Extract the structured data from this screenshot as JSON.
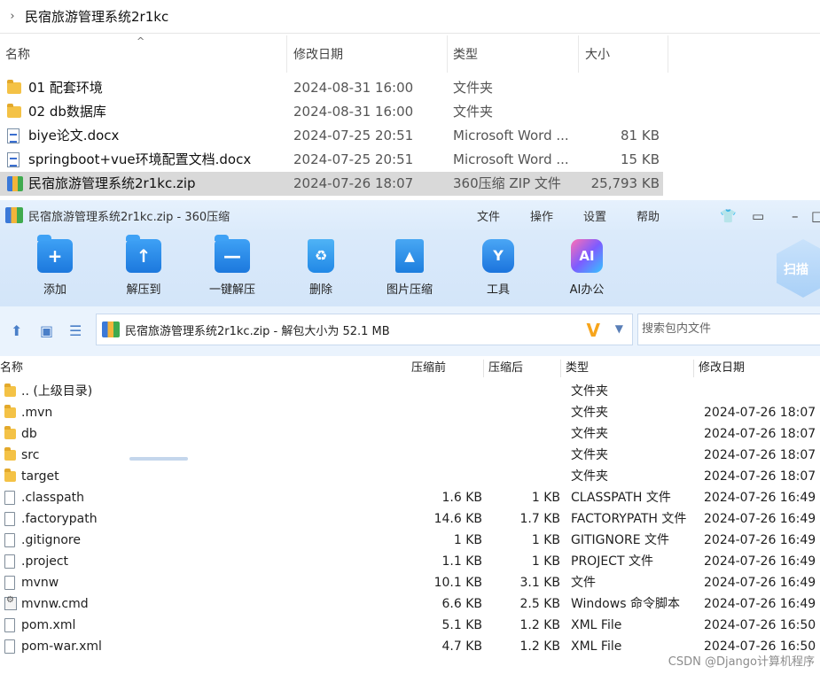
{
  "explorer": {
    "path": "民宿旅游管理系统2r1kc",
    "columns": {
      "name": "名称",
      "date": "修改日期",
      "type": "类型",
      "size": "大小"
    },
    "rows": [
      {
        "icon": "folder-icon",
        "name": "01 配套环境",
        "date": "2024-08-31 16:00",
        "type": "文件夹",
        "size": ""
      },
      {
        "icon": "folder-icon",
        "name": "02 db数据库",
        "date": "2024-08-31 16:00",
        "type": "文件夹",
        "size": ""
      },
      {
        "icon": "word-doc-icon",
        "name": "biye论文.docx",
        "date": "2024-07-25 20:51",
        "type": "Microsoft Word ...",
        "size": "81 KB"
      },
      {
        "icon": "word-doc-icon",
        "name": "springboot+vue环境配置文档.docx",
        "date": "2024-07-25 20:51",
        "type": "Microsoft Word ...",
        "size": "15 KB"
      },
      {
        "icon": "zip-archive-icon",
        "name": "民宿旅游管理系统2r1kc.zip",
        "date": "2024-07-26 18:07",
        "type": "360压缩 ZIP 文件",
        "size": "25,793 KB"
      }
    ]
  },
  "zipwin": {
    "title": "民宿旅游管理系统2r1kc.zip - 360压缩",
    "menu": {
      "file": "文件",
      "ops": "操作",
      "settings": "设置",
      "help": "帮助"
    },
    "toolbar": {
      "add": "添加",
      "extract_to": "解压到",
      "one_click_extract": "一键解压",
      "delete": "删除",
      "image_compress": "图片压缩",
      "tools": "工具",
      "ai_office": "AI办公",
      "scan": "扫描"
    },
    "pathbar": {
      "text": "民宿旅游管理系统2r1kc.zip - 解包大小为 52.1 MB",
      "search_placeholder": "搜索包内文件"
    },
    "columns": {
      "name": "名称",
      "compressed_before": "压缩前",
      "compressed_after": "压缩后",
      "type": "类型",
      "date": "修改日期"
    },
    "rows": [
      {
        "icon": "folder-icon",
        "name": ".. (上级目录)",
        "before": "",
        "after": "",
        "type": "文件夹",
        "date": ""
      },
      {
        "icon": "folder-icon",
        "name": ".mvn",
        "before": "",
        "after": "",
        "type": "文件夹",
        "date": "2024-07-26 18:07"
      },
      {
        "icon": "folder-icon",
        "name": "db",
        "before": "",
        "after": "",
        "type": "文件夹",
        "date": "2024-07-26 18:07"
      },
      {
        "icon": "folder-icon",
        "name": "src",
        "before": "",
        "after": "",
        "type": "文件夹",
        "date": "2024-07-26 18:07"
      },
      {
        "icon": "folder-icon",
        "name": "target",
        "before": "",
        "after": "",
        "type": "文件夹",
        "date": "2024-07-26 18:07"
      },
      {
        "icon": "file-icon",
        "name": ".classpath",
        "before": "1.6 KB",
        "after": "1 KB",
        "type": "CLASSPATH 文件",
        "date": "2024-07-26 16:49"
      },
      {
        "icon": "file-icon",
        "name": ".factorypath",
        "before": "14.6 KB",
        "after": "1.7 KB",
        "type": "FACTORYPATH 文件",
        "date": "2024-07-26 16:49"
      },
      {
        "icon": "file-icon",
        "name": ".gitignore",
        "before": "1 KB",
        "after": "1 KB",
        "type": "GITIGNORE 文件",
        "date": "2024-07-26 16:49"
      },
      {
        "icon": "file-icon",
        "name": ".project",
        "before": "1.1 KB",
        "after": "1 KB",
        "type": "PROJECT 文件",
        "date": "2024-07-26 16:49"
      },
      {
        "icon": "file-icon",
        "name": "mvnw",
        "before": "10.1 KB",
        "after": "3.1 KB",
        "type": "文件",
        "date": "2024-07-26 16:49"
      },
      {
        "icon": "cmd-script-icon",
        "name": "mvnw.cmd",
        "before": "6.6 KB",
        "after": "2.5 KB",
        "type": "Windows 命令脚本",
        "date": "2024-07-26 16:49"
      },
      {
        "icon": "file-icon",
        "name": "pom.xml",
        "before": "5.1 KB",
        "after": "1.2 KB",
        "type": "XML File",
        "date": "2024-07-26 16:50"
      },
      {
        "icon": "file-icon",
        "name": "pom-war.xml",
        "before": "4.7 KB",
        "after": "1.2 KB",
        "type": "XML File",
        "date": "2024-07-26 16:50"
      }
    ]
  },
  "watermark": "CSDN @Django计算机程序"
}
